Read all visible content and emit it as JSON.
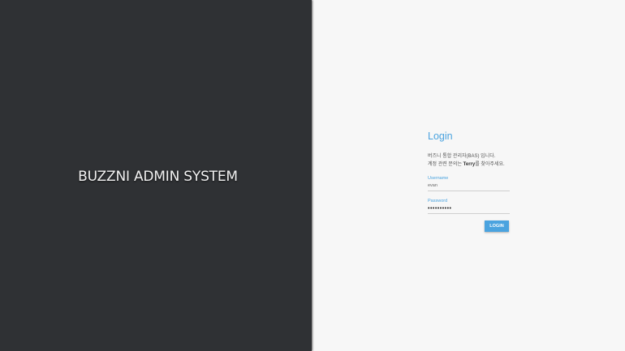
{
  "brand": {
    "title": "BUZZNI ADMIN SYSTEM"
  },
  "login": {
    "title": "Login",
    "description_line1": "버즈니 통합 관리자(BAS) 입니다.",
    "description_line2_prefix": "계정 관련 문의는 ",
    "description_line2_name": "Terry",
    "description_line2_suffix": "를 찾아주세요.",
    "username_label": "Username",
    "username_value": "evan",
    "password_label": "Password",
    "password_value": "••••••••••",
    "submit_label": "LOGIN"
  },
  "colors": {
    "left_background": "#2f3134",
    "right_background": "#f7f7f7",
    "accent": "#4aa3df"
  }
}
